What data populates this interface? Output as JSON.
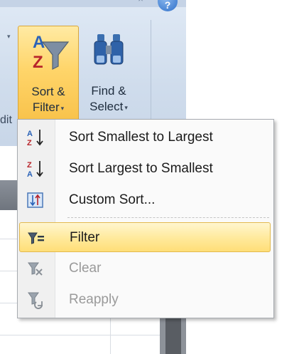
{
  "ribbon": {
    "sort_filter": {
      "line1": "Sort &",
      "line2": "Filter",
      "caret": "▾"
    },
    "find_select": {
      "line1": "Find &",
      "line2": "Select",
      "caret": "▾"
    },
    "group_label_partial": "dit",
    "close_glyph": "×",
    "help_glyph": "?"
  },
  "menu": {
    "items": [
      {
        "label": "Sort Smallest to Largest",
        "icon": "sort-a-to-z-icon",
        "enabled": true
      },
      {
        "label": "Sort Largest to Smallest",
        "icon": "sort-z-to-a-icon",
        "enabled": true
      },
      {
        "label": "Custom Sort...",
        "icon": "custom-sort-icon",
        "enabled": true
      },
      {
        "label": "Filter",
        "icon": "filter-icon",
        "enabled": true,
        "highlighted": true
      },
      {
        "label": "Clear",
        "icon": "clear-filter-icon",
        "enabled": false
      },
      {
        "label": "Reapply",
        "icon": "reapply-filter-icon",
        "enabled": false
      }
    ]
  },
  "colors": {
    "highlight": "#ffe99a",
    "ribbon_bg": "#d5e1ef",
    "disabled_text": "#9a9a9a"
  }
}
